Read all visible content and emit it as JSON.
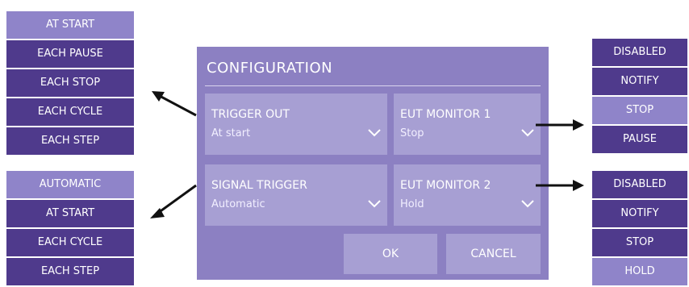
{
  "trigger_out_menu": {
    "items": [
      "AT START",
      "EACH PAUSE",
      "EACH STOP",
      "EACH CYCLE",
      "EACH STEP"
    ],
    "selected": "AT START"
  },
  "signal_trigger_menu": {
    "items": [
      "AUTOMATIC",
      "AT START",
      "EACH CYCLE",
      "EACH STEP"
    ],
    "selected": "AUTOMATIC"
  },
  "eut_monitor_1_menu": {
    "items": [
      "DISABLED",
      "NOTIFY",
      "STOP",
      "PAUSE"
    ],
    "selected": "STOP"
  },
  "eut_monitor_2_menu": {
    "items": [
      "DISABLED",
      "NOTIFY",
      "STOP",
      "HOLD"
    ],
    "selected": "HOLD"
  },
  "dialog": {
    "title": "CONFIGURATION",
    "fields": {
      "trigger_out": {
        "label": "TRIGGER OUT",
        "value": "At start"
      },
      "eut_monitor_1": {
        "label": "EUT MONITOR 1",
        "value": "Stop"
      },
      "signal_trigger": {
        "label": "SIGNAL TRIGGER",
        "value": "Automatic"
      },
      "eut_monitor_2": {
        "label": "EUT MONITOR 2",
        "value": "Hold"
      }
    },
    "buttons": {
      "ok": "OK",
      "cancel": "CANCEL"
    }
  },
  "colors": {
    "menu_bg": "#4f3a8c",
    "menu_selected": "#8f84c9",
    "dialog_bg": "#8c80c2",
    "field_bg": "#a79fd3"
  },
  "icons": [
    "chevron-down-icon",
    "arrow-icon"
  ]
}
